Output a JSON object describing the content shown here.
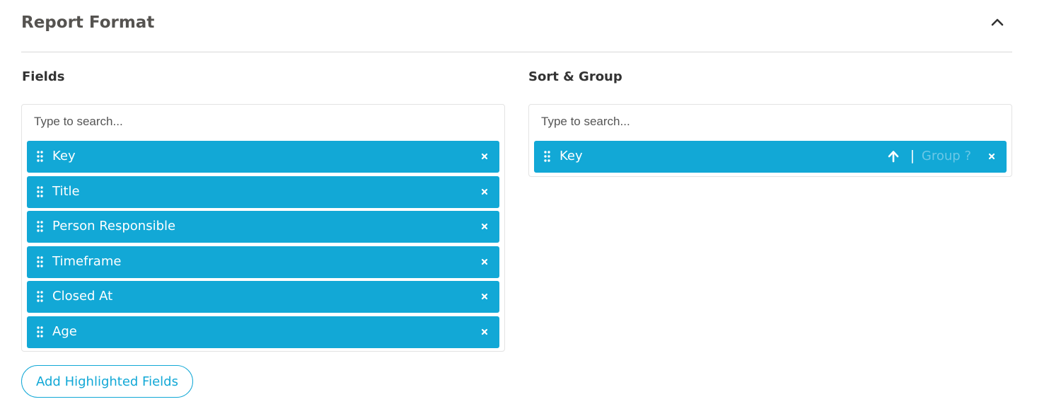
{
  "section": {
    "title": "Report Format",
    "collapse_icon": "chevron-up-icon"
  },
  "fields": {
    "label": "Fields",
    "search_placeholder": "Type to search...",
    "items": [
      {
        "label": "Key"
      },
      {
        "label": "Title"
      },
      {
        "label": "Person Responsible"
      },
      {
        "label": "Timeframe"
      },
      {
        "label": "Closed At"
      },
      {
        "label": "Age"
      }
    ],
    "add_button_label": "Add Highlighted Fields"
  },
  "sort_group": {
    "label": "Sort & Group",
    "search_placeholder": "Type to search...",
    "items": [
      {
        "label": "Key",
        "sort_direction": "ascending",
        "separator": "|",
        "group_label": "Group ?"
      }
    ]
  },
  "colors": {
    "accent": "#12a8d6",
    "title": "#555350",
    "group_text": "#6cc8e6"
  }
}
